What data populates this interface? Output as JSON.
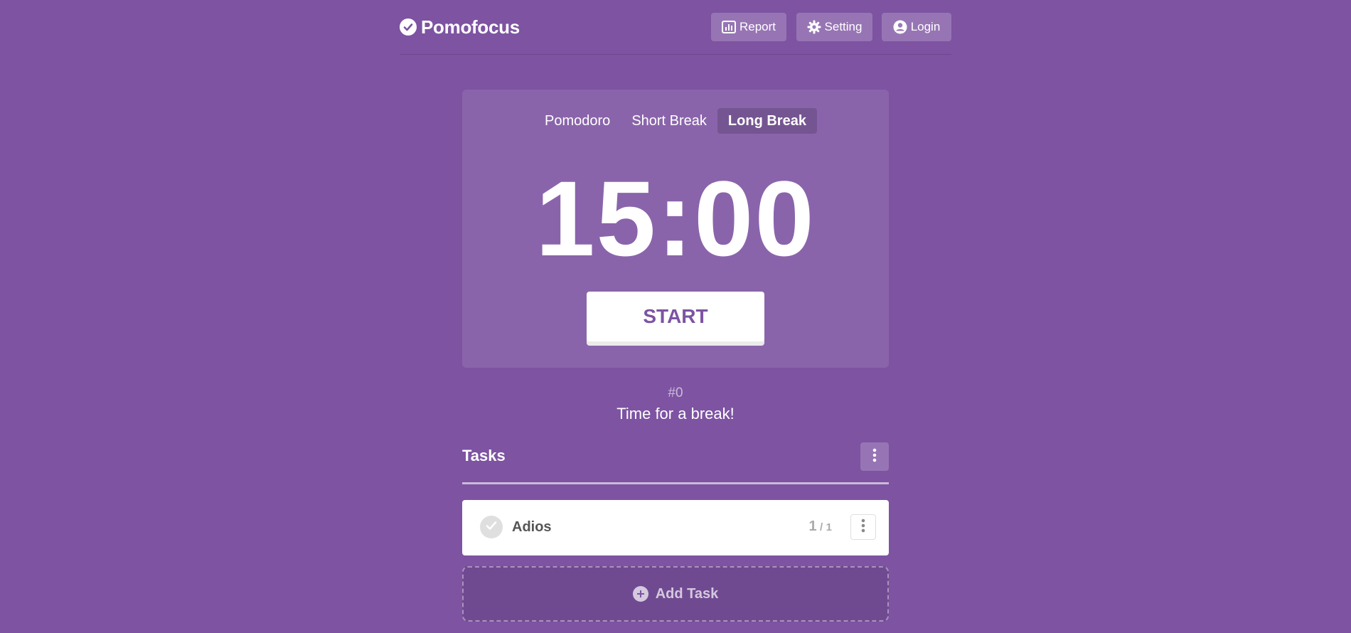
{
  "app": {
    "title": "Pomofocus",
    "logo_icon": "check-circle-icon"
  },
  "header": {
    "buttons": [
      {
        "label": "Report",
        "icon": "bar-chart-icon"
      },
      {
        "label": "Setting",
        "icon": "gear-icon"
      },
      {
        "label": "Login",
        "icon": "user-circle-icon"
      }
    ]
  },
  "timer": {
    "modes": [
      "Pomodoro",
      "Short Break",
      "Long Break"
    ],
    "active_mode": "Long Break",
    "time": "15:00",
    "start_label": "START"
  },
  "round": {
    "number": "#0",
    "message": "Time for a break!"
  },
  "tasks": {
    "title": "Tasks",
    "items": [
      {
        "name": "Adios",
        "done": "1",
        "sep": "/",
        "estimate": "1"
      }
    ],
    "add_label": "Add Task"
  },
  "colors": {
    "background": "#7D53A2",
    "accent_text": "#7D53A2",
    "card": "rgba(255,255,255,0.1)"
  }
}
